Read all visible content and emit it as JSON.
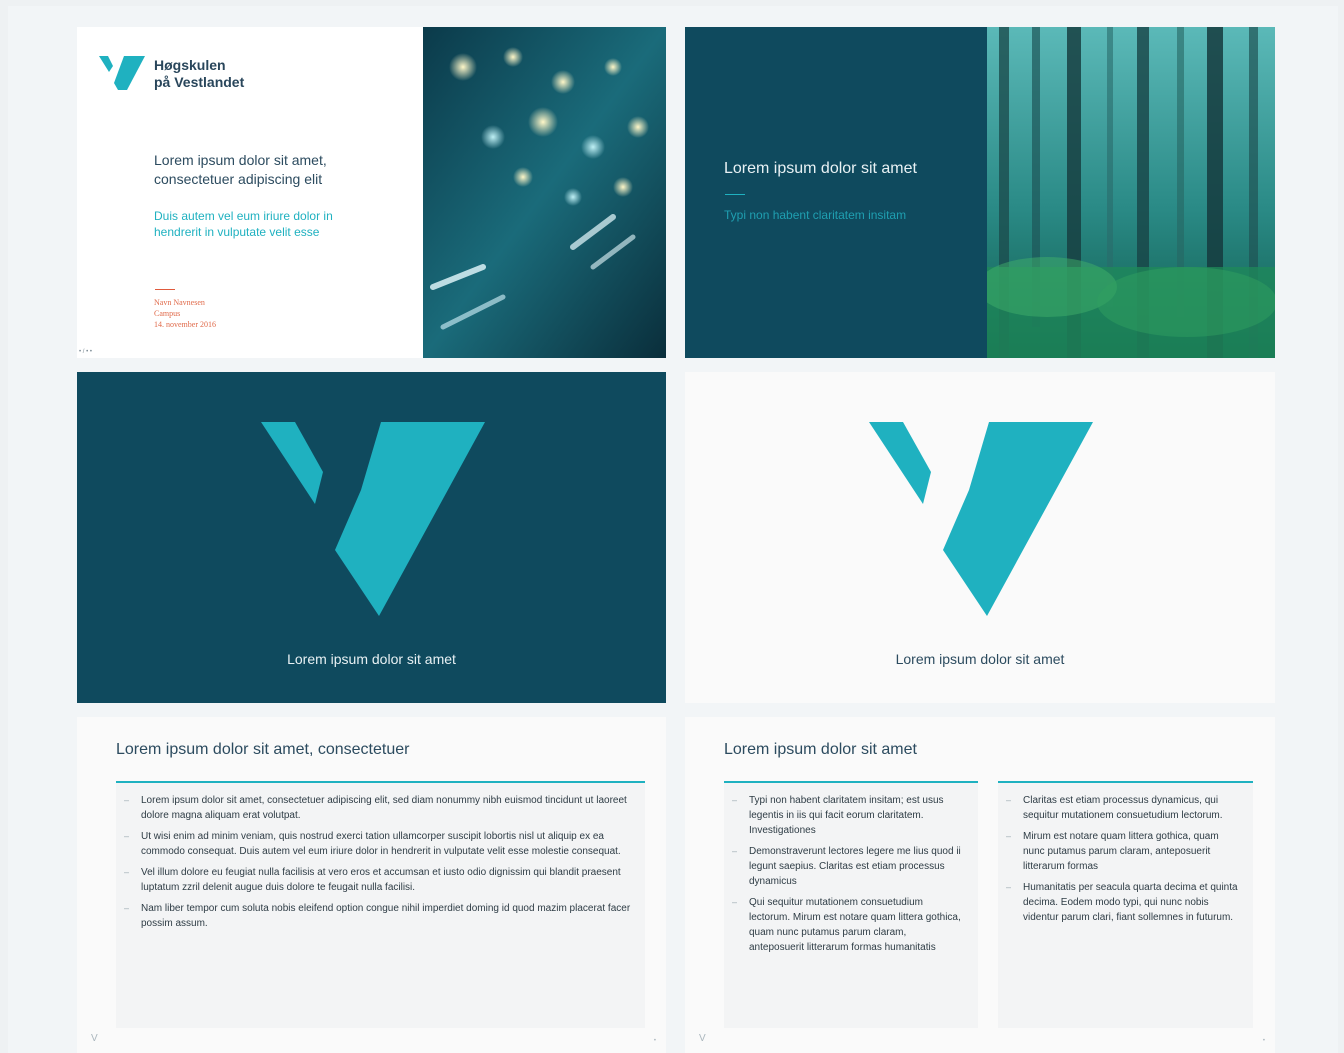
{
  "slide1": {
    "logo_line1": "Høgskulen",
    "logo_line2": "på Vestlandet",
    "title": "Lorem ipsum dolor sit amet, consectetuer adipiscing elit",
    "subtitle": "Duis autem vel eum iriure dolor in hendrerit in vulputate velit esse",
    "meta_name": "Navn Navnesen",
    "meta_place": "Campus",
    "meta_date": "14. november 2016",
    "page_number": "• / • •"
  },
  "slide2": {
    "title": "Lorem ipsum dolor sit amet",
    "subtitle": "Typi non habent claritatem insitam"
  },
  "slide3": {
    "title": "Lorem ipsum dolor sit amet"
  },
  "slide4": {
    "title": "Lorem ipsum dolor sit amet"
  },
  "slide5": {
    "title": "Lorem ipsum dolor sit amet, consectetuer",
    "bullets": [
      "Lorem ipsum dolor sit amet, consectetuer adipiscing elit, sed diam nonummy nibh euismod tincidunt ut laoreet dolore magna aliquam erat volutpat.",
      "Ut wisi enim ad minim veniam, quis nostrud exerci tation ullamcorper suscipit lobortis nisl ut aliquip ex ea commodo consequat. Duis autem vel eum iriure dolor in hendrerit in vulputate velit esse molestie consequat.",
      "Vel illum dolore eu feugiat nulla facilisis at vero eros et accumsan et iusto odio dignissim qui blandit praesent luptatum zzril delenit augue duis dolore te feugait nulla facilisi.",
      "Nam liber tempor cum soluta nobis eleifend option congue nihil imperdiet doming id quod mazim placerat facer possim assum."
    ]
  },
  "slide6": {
    "title": "Lorem ipsum dolor sit amet",
    "left_bullets": [
      "Typi non habent claritatem insitam; est usus legentis in iis qui facit eorum claritatem. Investigationes",
      "Demonstraverunt lectores legere me lius quod ii legunt saepius. Claritas est etiam processus dynamicus",
      "Qui sequitur mutationem consuetudium lectorum. Mirum est notare quam littera gothica, quam nunc putamus parum claram, anteposuerit litterarum formas humanitatis"
    ],
    "right_bullets": [
      "Claritas est etiam processus dynamicus, qui sequitur mutationem consuetudium lectorum.",
      "Mirum est notare quam littera gothica, quam nunc putamus parum claram, anteposuerit litterarum formas",
      "Humanitatis per seacula quarta decima et quinta decima. Eodem modo typi, qui nunc nobis videntur parum clari, fiant sollemnes in futurum."
    ]
  },
  "footer": {
    "logo": "V",
    "page": "•"
  },
  "colors": {
    "teal": "#1fb1c0",
    "navy": "#0f4a5e",
    "text": "#2c4b5f",
    "accent_orange": "#e06a4a"
  }
}
